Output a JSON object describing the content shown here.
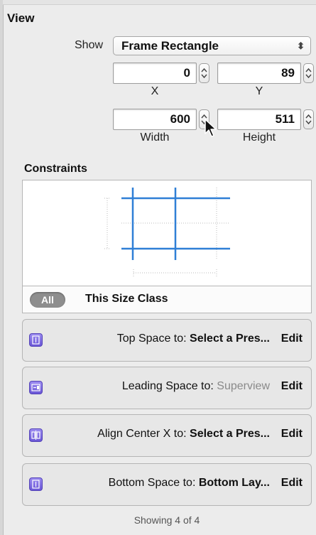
{
  "view": {
    "heading": "View",
    "show_label": "Show",
    "show_value": "Frame Rectangle",
    "x_value": "0",
    "y_value": "89",
    "x_label": "X",
    "y_label": "Y",
    "width_value": "600",
    "height_value": "511",
    "width_label": "Width",
    "height_label": "Height"
  },
  "constraints": {
    "heading": "Constraints",
    "size_class_pill": "All",
    "size_class_label": "This Size Class",
    "rows": [
      {
        "label": "Top Space to:",
        "value": "Select a Pres...",
        "muted": false,
        "edit": "Edit",
        "icon": "vertical-spacing-icon"
      },
      {
        "label": "Leading Space to:",
        "value": "Superview",
        "muted": true,
        "edit": "Edit",
        "icon": "leading-spacing-icon"
      },
      {
        "label": "Align Center X to:",
        "value": "Select a Pres...",
        "muted": false,
        "edit": "Edit",
        "icon": "center-x-alignment-icon"
      },
      {
        "label": "Bottom Space to:",
        "value": "Bottom Lay...",
        "muted": false,
        "edit": "Edit",
        "icon": "vertical-spacing-icon"
      }
    ],
    "footer": "Showing 4 of 4"
  },
  "colors": {
    "constraint_line": "#2f7fd6",
    "icon_fill": "#7b68e6"
  }
}
